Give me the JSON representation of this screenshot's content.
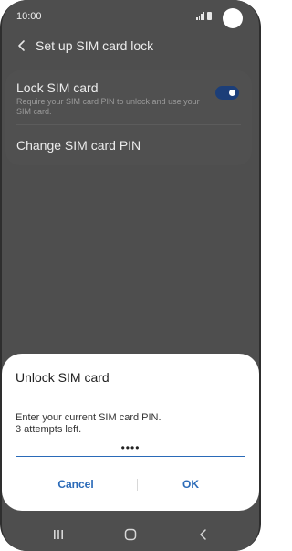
{
  "status_bar": {
    "time": "10:00",
    "icons": [
      "signal-icon",
      "battery-icon",
      "camera-cutout"
    ]
  },
  "app_bar": {
    "back_icon": "back-arrow-icon",
    "title": "Set up SIM card lock"
  },
  "settings": {
    "lock_sim": {
      "title": "Lock SIM card",
      "description": "Require your SIM card PIN to unlock and use your SIM card.",
      "toggle_on": true
    },
    "change_pin": {
      "title": "Change SIM card PIN"
    }
  },
  "dialog": {
    "title": "Unlock SIM card",
    "message_line1": "Enter your current SIM card PIN.",
    "message_line2": "3 attempts left.",
    "pin_value": "••••",
    "cancel_label": "Cancel",
    "ok_label": "OK"
  },
  "nav_bar": {
    "icons": [
      "recent-apps-icon",
      "home-icon",
      "back-icon"
    ]
  },
  "colors": {
    "accent": "#2a6ab8",
    "toggle_on": "#1c3e78",
    "dim_background": "#4e4e4e",
    "dialog_background": "#ffffff"
  }
}
